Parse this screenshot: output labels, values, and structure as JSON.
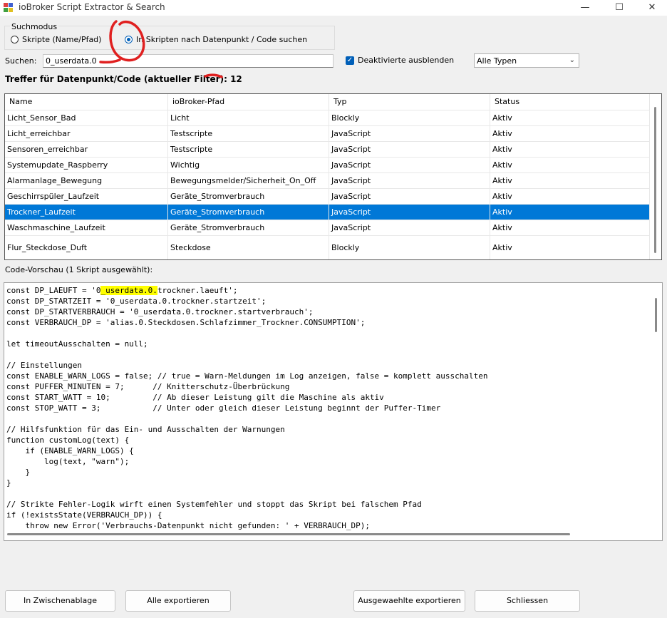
{
  "window": {
    "title": "ioBroker Script Extractor & Search",
    "minimize": "—",
    "maximize": "☐",
    "close": "✕"
  },
  "mode": {
    "legend": "Suchmodus",
    "option_names": "Skripte (Name/Pfad)",
    "option_code": "In Skripten nach Datenpunkt / Code suchen",
    "selected": "code"
  },
  "search": {
    "label": "Suchen:",
    "value": "0_userdata.0",
    "hide_disabled_label": "Deaktivierte ausblenden",
    "hide_disabled_checked": true,
    "type_filter": "Alle Typen"
  },
  "hits_text": "Treffer für Datenpunkt/Code (aktueller Filter): 12",
  "table": {
    "columns": [
      "Name",
      "ioBroker-Pfad",
      "Typ",
      "Status"
    ],
    "rows": [
      [
        "Licht_Sensor_Bad",
        "Licht",
        "Blockly",
        "Aktiv"
      ],
      [
        "Licht_erreichbar",
        "Testscripte",
        "JavaScript",
        "Aktiv"
      ],
      [
        "Sensoren_erreichbar",
        "Testscripte",
        "JavaScript",
        "Aktiv"
      ],
      [
        "Systemupdate_Raspberry",
        "Wichtig",
        "JavaScript",
        "Aktiv"
      ],
      [
        "Alarmanlage_Bewegung",
        "Bewegungsmelder/Sicherheit_On_Off",
        "JavaScript",
        "Aktiv"
      ],
      [
        "Geschirrspüler_Laufzeit",
        "Geräte_Stromverbrauch",
        "JavaScript",
        "Aktiv"
      ],
      [
        "Trockner_Laufzeit",
        "Geräte_Stromverbrauch",
        "JavaScript",
        "Aktiv"
      ],
      [
        "Waschmaschine_Laufzeit",
        "Geräte_Stromverbrauch",
        "JavaScript",
        "Aktiv"
      ],
      [
        "Flur_Steckdose_Duft",
        "Steckdose",
        "Blockly",
        "Aktiv"
      ]
    ],
    "selected_index": 6
  },
  "code_preview": {
    "label": "Code-Vorschau (1 Skript ausgewählt):",
    "highlight": "_userdata.0.",
    "lines": [
      "const DP_LAEUFT = '0_userdata.0.trockner.laeuft';",
      "const DP_STARTZEIT = '0_userdata.0.trockner.startzeit';",
      "const DP_STARTVERBRAUCH = '0_userdata.0.trockner.startverbrauch';",
      "const VERBRAUCH_DP = 'alias.0.Steckdosen.Schlafzimmer_Trockner.CONSUMPTION';",
      "",
      "let timeoutAusschalten = null;",
      "",
      "// Einstellungen",
      "const ENABLE_WARN_LOGS = false; // true = Warn-Meldungen im Log anzeigen, false = komplett ausschalten",
      "const PUFFER_MINUTEN = 7;      // Knitterschutz-Überbrückung",
      "const START_WATT = 10;         // Ab dieser Leistung gilt die Maschine als aktiv",
      "const STOP_WATT = 3;           // Unter oder gleich dieser Leistung beginnt der Puffer-Timer",
      "",
      "// Hilfsfunktion für das Ein- und Ausschalten der Warnungen",
      "function customLog(text) {",
      "    if (ENABLE_WARN_LOGS) {",
      "        log(text, \"warn\");",
      "    }",
      "}",
      "",
      "// Strikte Fehler-Logik wirft einen Systemfehler und stoppt das Skript bei falschem Pfad",
      "if (!existsState(VERBRAUCH_DP)) {",
      "    throw new Error('Verbrauchs-Datenpunkt nicht gefunden: ' + VERBRAUCH_DP);"
    ]
  },
  "buttons": {
    "clipboard": "In Zwischenablage",
    "export_all": "Alle exportieren",
    "export_selected": "Ausgewaehlte exportieren",
    "close": "Schliessen"
  },
  "colors": {
    "accent": "#0078d7",
    "highlight": "#ffff00",
    "annotation": "#e02020"
  }
}
